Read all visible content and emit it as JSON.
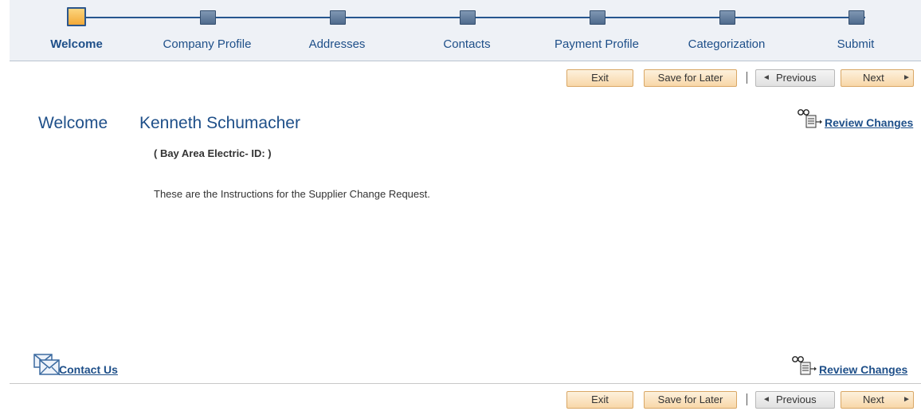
{
  "train": {
    "steps": [
      {
        "label": "Welcome",
        "current": true
      },
      {
        "label": "Company Profile",
        "current": false
      },
      {
        "label": "Addresses",
        "current": false
      },
      {
        "label": "Contacts",
        "current": false
      },
      {
        "label": "Payment Profile",
        "current": false
      },
      {
        "label": "Categorization",
        "current": false
      },
      {
        "label": "Submit",
        "current": false
      }
    ]
  },
  "toolbar": {
    "exit_label": "Exit",
    "save_label": "Save for Later",
    "previous_label": "Previous",
    "next_label": "Next",
    "previous_icon": "◄",
    "next_icon": "►"
  },
  "main": {
    "welcome_word": "Welcome",
    "user_name": "Kenneth Schumacher",
    "company_line": "( Bay Area Electric-  ID: )",
    "instructions": "These are the Instructions for the Supplier Change Request.",
    "review_changes_label": "Review Changes",
    "contact_us_label": "Contact Us"
  },
  "colors": {
    "accent": "#1e4f89",
    "train_bg": "#eef1f6",
    "current_step": "#f3a937",
    "button_bg": "#f8d7a8"
  },
  "icons": {
    "review": "review-changes-icon",
    "contact": "envelope-icon"
  }
}
